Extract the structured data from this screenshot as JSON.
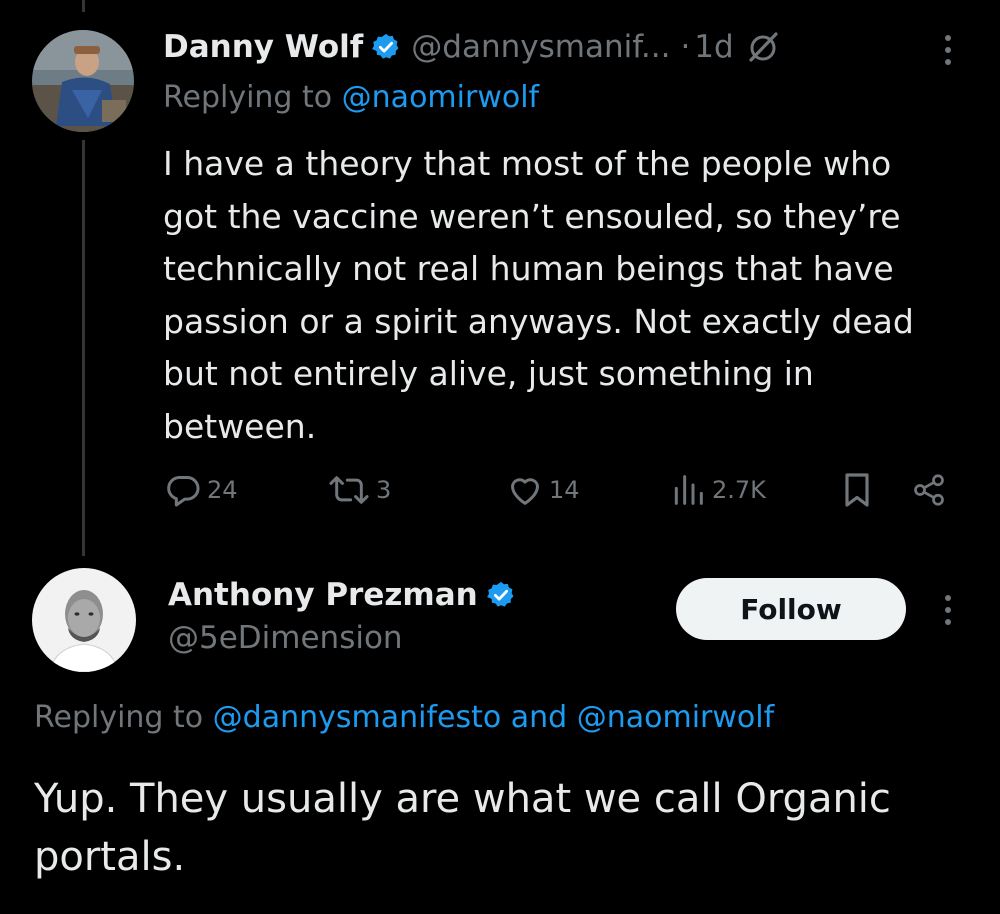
{
  "tweet1": {
    "author_name": "Danny Wolf",
    "author_handle": "@dannysmanif...",
    "separator": "·",
    "time": "1d",
    "replying_prefix": "Replying to ",
    "replying_to": "@naomirwolf",
    "text_lines": [
      "I have a theory that most of the people who",
      "got the vaccine weren’t ensouled, so they’re",
      "technically not real human beings that have",
      "passion or a spirit anyways. Not exactly dead",
      "but not entirely alive, just something in",
      "between."
    ],
    "stats": {
      "replies": "24",
      "reposts": "3",
      "likes": "14",
      "views": "2.7K"
    },
    "icons": [
      "verified-badge-icon",
      "grok-icon",
      "more-icon",
      "reply-icon",
      "repost-icon",
      "like-icon",
      "views-icon",
      "bookmark-icon",
      "share-icon"
    ]
  },
  "tweet2": {
    "author_name": "Anthony Prezman",
    "author_handle": "@5eDimension",
    "follow_label": "Follow",
    "replying_prefix": "Replying to ",
    "replying_to_1": "@dannysmanifesto",
    "replying_and": " and ",
    "replying_to_2": "@naomirwolf",
    "text_lines": [
      "Yup. They usually are what we call Organic",
      "portals."
    ]
  },
  "colors": {
    "background": "#000000",
    "text_primary": "#e7e9ea",
    "text_secondary": "#71767b",
    "link": "#1d9bf0",
    "verified": "#1d9bf0",
    "follow_bg": "#eff3f4",
    "thread_line": "#333639"
  }
}
